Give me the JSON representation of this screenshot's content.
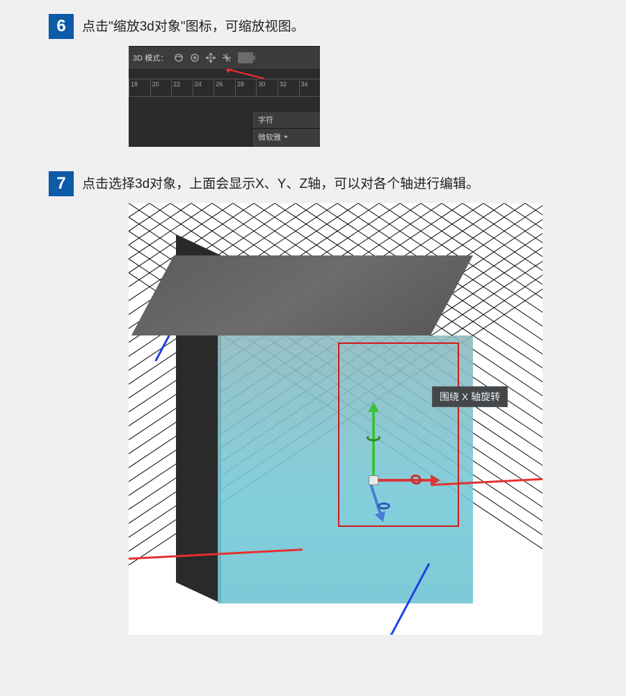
{
  "steps": {
    "s6": {
      "num": "6",
      "text": "点击\"缩放3d对象\"图标，可缩放视图。"
    },
    "s7": {
      "num": "7",
      "text": "点击选择3d对象，上面会显示X、Y、Z轴，可以对各个轴进行编辑。"
    }
  },
  "toolbar": {
    "mode_label": "3D 模式：",
    "callout": "缩放3d对象",
    "ruler_ticks": [
      "18",
      "20",
      "22",
      "24",
      "26",
      "28",
      "30",
      "32",
      "34"
    ],
    "panel_tab": "字符",
    "panel_font": "微软雅"
  },
  "scene": {
    "tooltip": "围绕 X 轴旋转"
  }
}
